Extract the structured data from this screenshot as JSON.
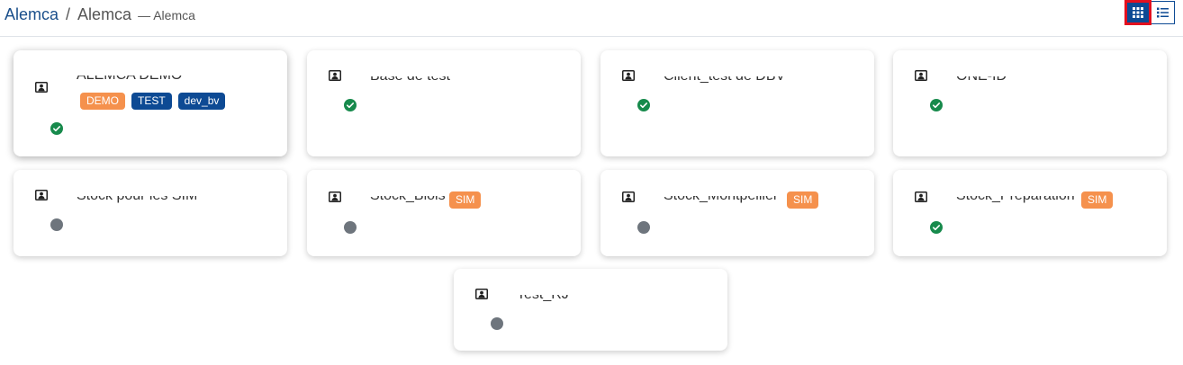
{
  "breadcrumb": {
    "root": "Alemca",
    "separator": "/",
    "current": "Alemca",
    "subtitle": "— Alemca"
  },
  "view_toggle": {
    "grid_icon": "grid-icon",
    "list_icon": "list-icon",
    "active": "grid"
  },
  "colors": {
    "brand": "#1a4f8b",
    "toggle_active": "#0d4a94",
    "toggle_highlight": "#e3101f",
    "badge_orange": "#f5914d",
    "badge_navy": "#0d4a94",
    "status_ok": "#178a4c",
    "status_off": "#6e757d"
  },
  "cards": [
    {
      "title": "ALEMCA DEMO",
      "badges": [
        {
          "label": "DEMO"
        },
        {
          "label": "TEST"
        },
        {
          "label": "dev_bv"
        }
      ],
      "status": "ok",
      "icon": "user-card-icon"
    },
    {
      "title": "Base de test",
      "badges": [],
      "status": "ok",
      "icon": "user-card-icon"
    },
    {
      "title": "Client_test de DBV",
      "badges": [],
      "status": "ok",
      "icon": "user-card-icon"
    },
    {
      "title": "ONE-ID",
      "badges": [],
      "status": "ok",
      "icon": "user-card-icon"
    },
    {
      "title": "Stock pour les SIM",
      "badges": [],
      "status": "off",
      "icon": "user-card-icon"
    },
    {
      "title": "Stock_Blois",
      "badges": [
        {
          "label": "SIM"
        }
      ],
      "status": "off",
      "icon": "user-card-icon"
    },
    {
      "title": "Stock_Montpellier",
      "badges": [
        {
          "label": "SIM"
        }
      ],
      "status": "off",
      "icon": "user-card-icon"
    },
    {
      "title": "Stock_Preparation",
      "badges": [
        {
          "label": "SIM"
        }
      ],
      "status": "ok",
      "icon": "user-card-icon"
    },
    {
      "title": "Test_RJ",
      "badges": [],
      "status": "off",
      "icon": "user-card-icon"
    }
  ]
}
